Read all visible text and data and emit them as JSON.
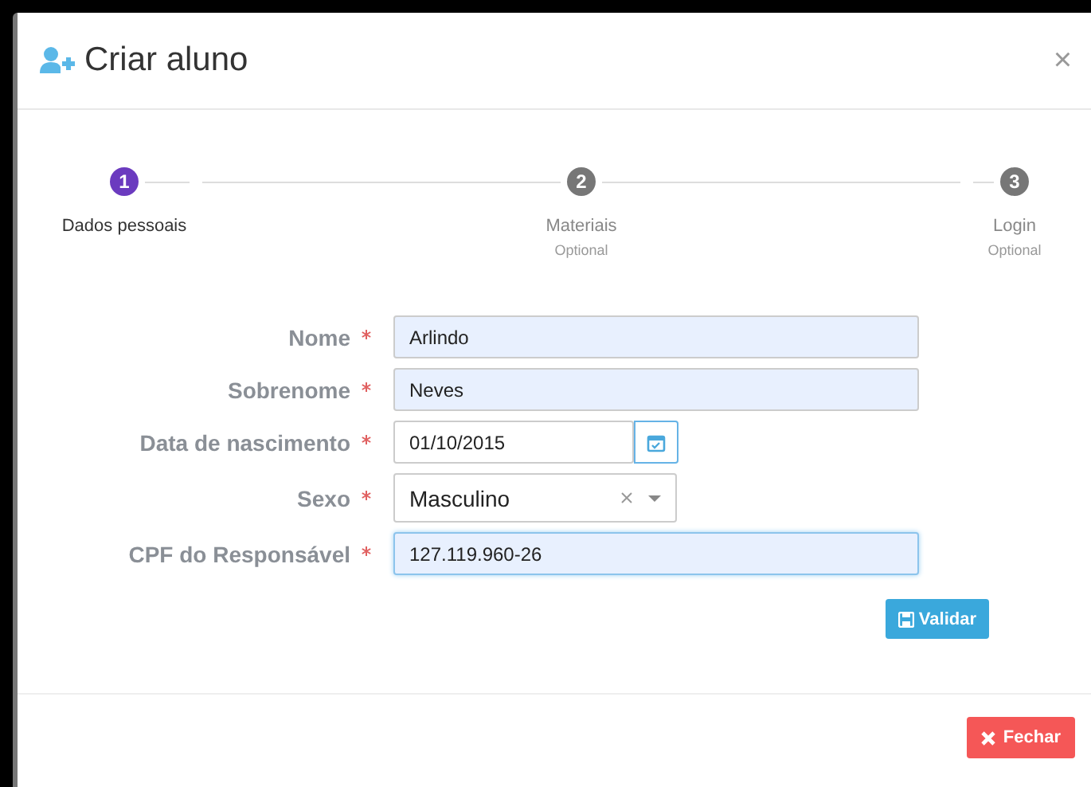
{
  "dialog": {
    "title": "Criar aluno",
    "close": "×"
  },
  "steps": [
    {
      "number": "1",
      "label": "Dados pessoais",
      "selected": true
    },
    {
      "number": "2",
      "label": "Materiais",
      "sublabel": "Optional",
      "selected": false
    },
    {
      "number": "3",
      "label": "Login",
      "sublabel": "Optional",
      "selected": false
    }
  ],
  "fields": [
    {
      "kind": "text",
      "label": "Nome",
      "required": true,
      "value": "Arlindo",
      "focused": false
    },
    {
      "kind": "text",
      "label": "Sobrenome",
      "required": true,
      "value": "Neves",
      "focused": false
    },
    {
      "kind": "date",
      "label": "Data de nascimento",
      "required": true,
      "value": "01/10/2015",
      "focused": false
    },
    {
      "kind": "select",
      "label": "Sexo",
      "required": true,
      "value": "Masculino",
      "focused": false
    },
    {
      "kind": "text",
      "label": "CPF do Responsável",
      "required": true,
      "value": "127.119.960-26",
      "focused": true
    }
  ],
  "validate_button": "Validar",
  "close_button": "Fechar"
}
